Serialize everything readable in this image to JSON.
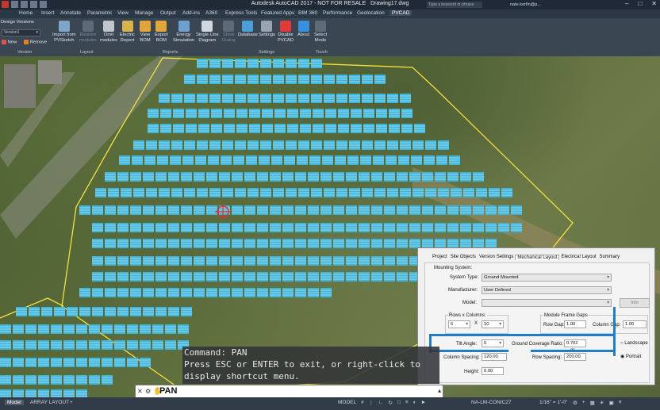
{
  "window": {
    "title": "Autodesk AutoCAD 2017 - NOT FOR RESALE",
    "document": "Drawing17.dwg",
    "search_placeholder": "Type a keyword or phrase",
    "user": "nate.kerfin@p..."
  },
  "tabs": [
    {
      "label": "Home"
    },
    {
      "label": "Insert"
    },
    {
      "label": "Annotate"
    },
    {
      "label": "Parametric"
    },
    {
      "label": "View"
    },
    {
      "label": "Manage"
    },
    {
      "label": "Output"
    },
    {
      "label": "Add-ins"
    },
    {
      "label": "A360"
    },
    {
      "label": "Express Tools"
    },
    {
      "label": "Featured Apps"
    },
    {
      "label": "BIM 360"
    },
    {
      "label": "Performance"
    },
    {
      "label": "Geolocation"
    },
    {
      "label": "PVCAD"
    }
  ],
  "ribbon": {
    "design_versions_label": "Design Versions",
    "version_value": "Version1",
    "new_label": "New",
    "remove_label": "Remove",
    "buttons": [
      {
        "label": "Import from\nPVSketch",
        "icon": "import-icon",
        "dim": false
      },
      {
        "label": "Restore\nmodules",
        "icon": "restore-icon",
        "dim": true
      },
      {
        "label": "Omit\nmodules",
        "icon": "omit-icon",
        "dim": false
      },
      {
        "label": "Electric\nReport",
        "icon": "electric-report-icon",
        "dim": false
      },
      {
        "label": "View\nBOM",
        "icon": "view-bom-icon",
        "dim": false
      },
      {
        "label": "Export\nBOM",
        "icon": "export-bom-icon",
        "dim": false
      },
      {
        "label": "Energy\nSimulation",
        "icon": "energy-icon",
        "dim": false
      },
      {
        "label": "Single Line\nDiagram",
        "icon": "single-line-icon",
        "dim": false
      },
      {
        "label": "Show\nDialog",
        "icon": "show-dialog-icon",
        "dim": true
      },
      {
        "label": "Database",
        "icon": "database-icon",
        "dim": false
      },
      {
        "label": "Settings",
        "icon": "settings-icon",
        "dim": false
      },
      {
        "label": "Disable\nPVCAD",
        "icon": "disable-icon",
        "dim": false
      },
      {
        "label": "About",
        "icon": "about-icon",
        "dim": false
      },
      {
        "label": "Select\nMode",
        "icon": "select-mode-icon",
        "dim": false
      }
    ],
    "panels": [
      "Version",
      "Layout",
      "Reports",
      "Settings",
      "Touch"
    ]
  },
  "dialog": {
    "tabs": [
      "Project",
      "Site Objects",
      "Version Settings",
      "Mechanical Layout",
      "Electrical Layout",
      "Summary"
    ],
    "active_tab": "Mechanical Layout",
    "mounting_system_label": "Mounting System:",
    "system_type_label": "System Type:",
    "system_type_value": "Ground Mounted",
    "manufacturer_label": "Manufacturer:",
    "manufacturer_value": "User Defined",
    "model_label": "Model:",
    "model_value": "",
    "info_label": "Info",
    "rows_columns_label": "Rows x Columns:",
    "rows_value": "6",
    "columns_value": "10",
    "x_label": "X",
    "frame_gaps_label": "Module Frame Gaps",
    "row_gap_label": "Row Gap:",
    "row_gap_value": "1.00",
    "column_gap_label": "Column Gap:",
    "column_gap_value": "1.00",
    "tilt_angle_label": "Tilt Angle:",
    "tilt_angle_value": "5",
    "gcr_label": "Ground Coverage Ratio:",
    "gcr_value": "0.702",
    "or_label": "or",
    "column_spacing_label": "Column Spacing:",
    "column_spacing_value": "120.00",
    "row_spacing_label": "Row Spacing:",
    "row_spacing_value": "200.00",
    "height_label": "Height:",
    "height_value": "0.00",
    "landscape_label": "Landscape",
    "portrait_label": "Portrait",
    "orientation_selected": "Portrait"
  },
  "command": {
    "history": [
      "Command: PAN",
      "Press ESC or ENTER to exit, or right-click to",
      "display shortcut menu."
    ],
    "current": "PAN"
  },
  "status": {
    "tabs": [
      "Model",
      "ARRAY LAYOUT"
    ],
    "active_tab": "Model",
    "model_label": "MODEL",
    "coord_system": "NA-LM-CONIC27",
    "scale": "1/16\" = 1'-0\""
  },
  "colors": {
    "panel_fill": "#3fb7dd",
    "panel_stripe": "#ffffff",
    "boundary": "#f2e23a",
    "active_tab": "#3c4a5a"
  }
}
